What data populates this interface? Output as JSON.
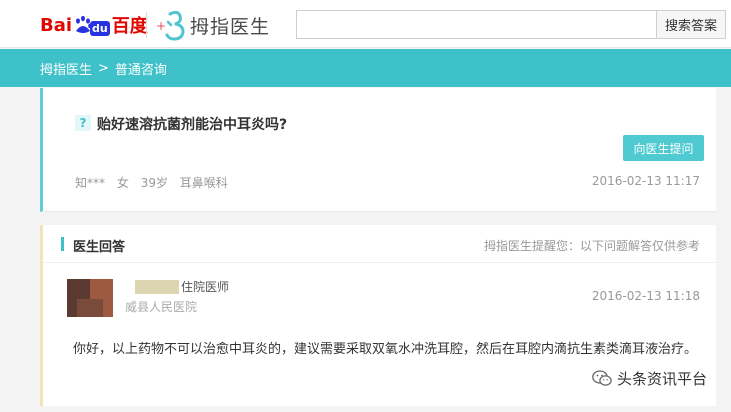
{
  "header": {
    "baidu_logo": {
      "bai": "Bai",
      "du": "du",
      "cn": "百度"
    },
    "brand_name": "拇指医生",
    "search": {
      "value": "",
      "placeholder": "",
      "button_label": "搜索答案"
    }
  },
  "breadcrumb": {
    "home": "拇指医生",
    "separator": ">",
    "current": "普通咨询"
  },
  "question": {
    "mark": "?",
    "title": "贻好速溶抗菌剂能治中耳炎吗?",
    "ask_button": "向医生提问",
    "user": "知***",
    "gender": "女",
    "age": "39岁",
    "department": "耳鼻喉科",
    "time": "2016-02-13 11:17"
  },
  "answer": {
    "header_title": "医生回答",
    "header_note": "拇指医生提醒您：以下问题解答仅供参考",
    "doctor_title": "住院医师",
    "doctor_hospital": "威县人民医院",
    "time": "2016-02-13 11:18",
    "body": "你好，以上药物不可以治愈中耳炎的，建议需要采取双氧水冲洗耳腔，然后在耳腔内滴抗生素类滴耳液治疗。"
  },
  "watermark": {
    "text": "头条资讯平台",
    "icon": "wechat-icon"
  },
  "colors": {
    "accent": "#3fc1c9",
    "baidu_red": "#e10602",
    "baidu_blue": "#2932e1",
    "answer_border": "#f1e5b8"
  }
}
